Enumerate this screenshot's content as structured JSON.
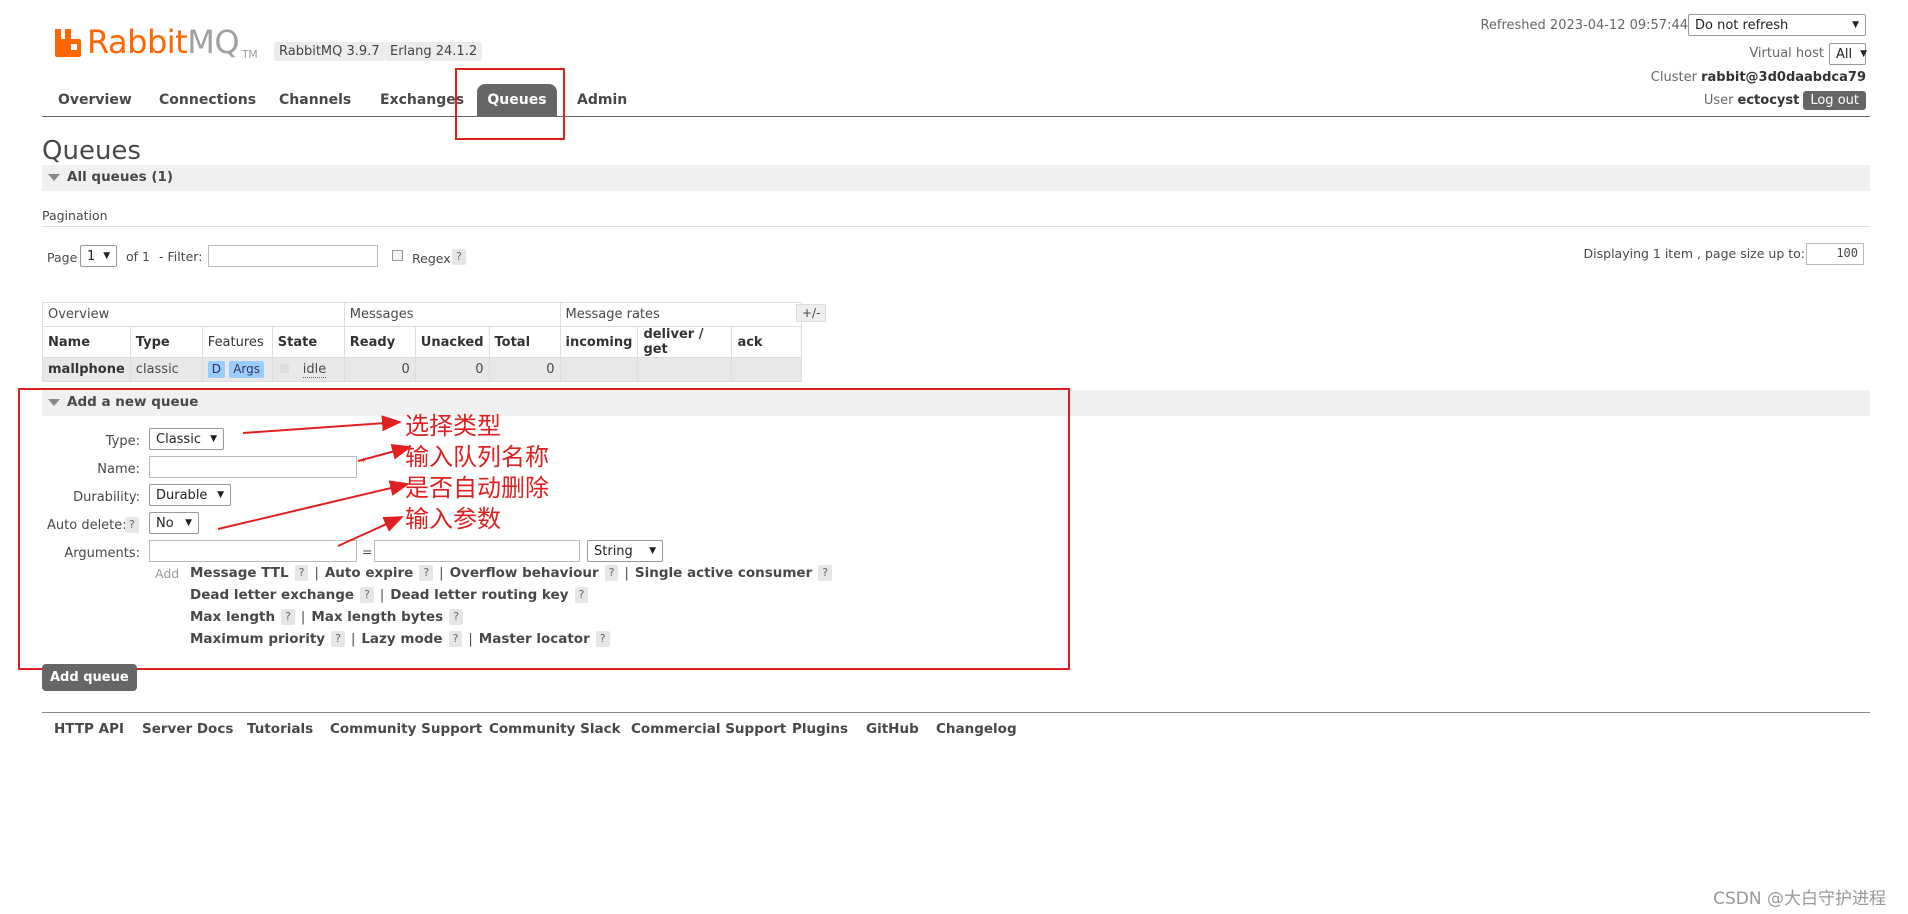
{
  "brand": {
    "name_part1": "Rabbit",
    "name_part2": "MQ",
    "tm": "TM"
  },
  "versions": {
    "rabbitmq": "RabbitMQ 3.9.7",
    "erlang": "Erlang 24.1.2"
  },
  "header": {
    "refreshed_label": "Refreshed 2023-04-12 09:57:44",
    "refresh_select": "Do not refresh",
    "vhost_label": "Virtual host",
    "vhost_select": "All",
    "cluster_label": "Cluster",
    "cluster_name": "rabbit@3d0daabdca79",
    "user_label": "User",
    "user_name": "ectocyst",
    "logout": "Log out"
  },
  "nav": {
    "overview": "Overview",
    "connections": "Connections",
    "channels": "Channels",
    "exchanges": "Exchanges",
    "queues": "Queues",
    "admin": "Admin"
  },
  "page_title": "Queues",
  "all_queues": {
    "label": "All queues (1)"
  },
  "pagination": {
    "label": "Pagination",
    "page_label": "Page",
    "page_value": "1",
    "of_label": "of 1",
    "filter_label": "- Filter:",
    "regex_label": "Regex",
    "help": "?",
    "displaying": "Displaying 1 item , page size up to:",
    "page_size": "100"
  },
  "table": {
    "groups": {
      "overview": "Overview",
      "messages": "Messages",
      "rates": "Message rates",
      "toggle": "+/-"
    },
    "headers": {
      "name": "Name",
      "type": "Type",
      "features": "Features",
      "state": "State",
      "ready": "Ready",
      "unacked": "Unacked",
      "total": "Total",
      "incoming": "incoming",
      "deliver": "deliver / get",
      "ack": "ack"
    },
    "rows": [
      {
        "name": "mallphone",
        "type": "classic",
        "feat_d": "D",
        "feat_args": "Args",
        "state": "idle",
        "ready": "0",
        "unacked": "0",
        "total": "0",
        "incoming": "",
        "deliver": "",
        "ack": ""
      }
    ]
  },
  "add_queue": {
    "section_label": "Add a new queue",
    "type_label": "Type:",
    "type_value": "Classic",
    "name_label": "Name:",
    "required_mark": "*",
    "durability_label": "Durability:",
    "durability_value": "Durable",
    "autodelete_label": "Auto delete:",
    "autodelete_value": "No",
    "arguments_label": "Arguments:",
    "equals": "=",
    "arg_type_value": "String",
    "add_label": "Add",
    "help": "?",
    "args": {
      "message_ttl": "Message TTL",
      "auto_expire": "Auto expire",
      "overflow": "Overflow behaviour",
      "single_active": "Single active consumer",
      "dlx": "Dead letter exchange",
      "dlrk": "Dead letter routing key",
      "max_length": "Max length",
      "max_length_bytes": "Max length bytes",
      "max_priority": "Maximum priority",
      "lazy_mode": "Lazy mode",
      "master_locator": "Master locator",
      "sep": "|"
    },
    "button": "Add queue"
  },
  "annotations": {
    "a1": "选择类型",
    "a2": "输入队列名称",
    "a3": "是否自动删除",
    "a4": "输入参数",
    "color": "#e02020"
  },
  "footer": {
    "http_api": "HTTP API",
    "server_docs": "Server Docs",
    "tutorials": "Tutorials",
    "community_support": "Community Support",
    "community_slack": "Community Slack",
    "commercial_support": "Commercial Support",
    "plugins": "Plugins",
    "github": "GitHub",
    "changelog": "Changelog"
  },
  "watermark": "CSDN @大白守护进程"
}
